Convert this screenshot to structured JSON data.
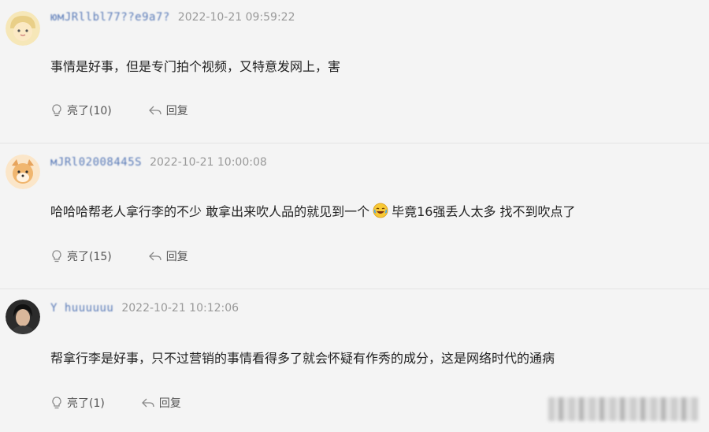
{
  "comments": [
    {
      "username": "юмJRllbl77??e9a7?",
      "timestamp": "2022-10-21 09:59:22",
      "text": "事情是好事，但是专门拍个视频，又特意发网上，害",
      "like_label": "亮了(10)",
      "reply_label": "回复",
      "avatar_icon": "cartoon-face-avatar"
    },
    {
      "username": "мJRl02008445S",
      "timestamp": "2022-10-21 10:00:08",
      "text_before": "哈哈哈帮老人拿行李的不少 敢拿出来吹人品的就见到一个",
      "emoji_icon": "laughing-crying-emoji",
      "text_after": "毕竟16强丢人太多 找不到吹点了",
      "like_label": "亮了(15)",
      "reply_label": "回复",
      "avatar_icon": "cartoon-dog-avatar"
    },
    {
      "username": "Y huuuuuu",
      "timestamp": "2022-10-21 10:12:06",
      "text": "帮拿行李是好事，只不过营销的事情看得多了就会怀疑有作秀的成分，这是网络时代的通病",
      "like_label": "亮了(1)",
      "reply_label": "回复",
      "avatar_icon": "photo-avatar-woman"
    }
  ],
  "colors": {
    "background": "#f4f4f4",
    "username": "#5a7bb8",
    "timestamp": "#999999",
    "text": "#222222",
    "action": "#555555"
  }
}
